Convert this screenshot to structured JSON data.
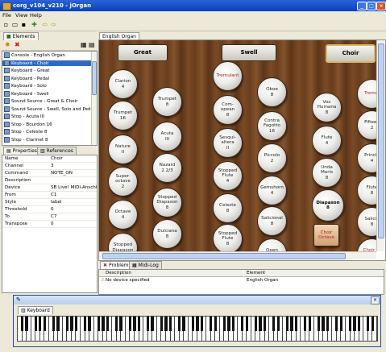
{
  "window": {
    "title": "corg_v104_v210 - jOrgan"
  },
  "menu": [
    "File",
    "View",
    "Help"
  ],
  "elements_tab": "Elements",
  "elements": [
    {
      "label": "Console - English Organ",
      "selected": false
    },
    {
      "label": "Keyboard - Choir",
      "selected": true
    },
    {
      "label": "Keyboard - Great",
      "selected": false
    },
    {
      "label": "Keyboard - Pedal",
      "selected": false
    },
    {
      "label": "Keyboard - Solo",
      "selected": false
    },
    {
      "label": "Keyboard - Swell",
      "selected": false
    },
    {
      "label": "Sound Source - Great & Choir",
      "selected": false
    },
    {
      "label": "Sound Source - Swell, Solo and Pedal",
      "selected": false
    },
    {
      "label": "Stop - Acuta  III",
      "selected": false
    },
    {
      "label": "Stop - Bourdon  16",
      "selected": false
    },
    {
      "label": "Stop - Celeste  8",
      "selected": false
    },
    {
      "label": "Stop - Clarinet  8",
      "selected": false
    }
  ],
  "props_tabs": [
    "Properties",
    "References"
  ],
  "properties": [
    {
      "key": "Name",
      "value": "Choir"
    },
    {
      "key": "Channel",
      "value": "3"
    },
    {
      "key": "Command",
      "value": "NOTE_ON"
    },
    {
      "key": "Description",
      "value": ""
    },
    {
      "key": "Device",
      "value": "SB Live! MIDI-Anschlus..."
    },
    {
      "key": "From",
      "value": "C1"
    },
    {
      "key": "Style",
      "value": "label"
    },
    {
      "key": "Threshold",
      "value": "0"
    },
    {
      "key": "To",
      "value": "C7"
    },
    {
      "key": "Transpose",
      "value": "0"
    }
  ],
  "console_tab": "English Organ",
  "manuals": {
    "great": "Great",
    "swell": "Swell",
    "choir": "Choir"
  },
  "stops": [
    {
      "label": "Clarion\n4",
      "red": false,
      "on": false
    },
    {
      "label": "Trumpet\n16",
      "red": false,
      "on": false
    },
    {
      "label": "Nature\nII",
      "red": false,
      "on": false
    },
    {
      "label": "Super-\noctave\n2",
      "red": false,
      "on": false
    },
    {
      "label": "Octave\n4",
      "red": false,
      "on": false
    },
    {
      "label": "Stopped\nDiapason",
      "red": false,
      "on": false
    },
    {
      "label": "Trumpet\n8",
      "red": false,
      "on": false
    },
    {
      "label": "Acuta\nIII",
      "red": false,
      "on": false
    },
    {
      "label": "Nazard\n2 2/3",
      "red": false,
      "on": false
    },
    {
      "label": "Stopped\nDiapason\n8",
      "red": false,
      "on": false
    },
    {
      "label": "Dulciana\n8",
      "red": false,
      "on": false
    },
    {
      "label": "Tremulant",
      "red": true,
      "on": false
    },
    {
      "label": "Com-\nopean\n8",
      "red": false,
      "on": false
    },
    {
      "label": "Sesqui-\naltera\nII",
      "red": false,
      "on": false
    },
    {
      "label": "Stopped\nFlute\n4",
      "red": false,
      "on": false
    },
    {
      "label": "Celeste\n8",
      "red": false,
      "on": false
    },
    {
      "label": "Stopped\nFlute\n8",
      "red": false,
      "on": false
    },
    {
      "label": "Oboe\n8",
      "red": false,
      "on": false
    },
    {
      "label": "Contra\nFagotto\n16",
      "red": false,
      "on": false
    },
    {
      "label": "Piccolo\n2",
      "red": false,
      "on": false
    },
    {
      "label": "Gemshorn\n4",
      "red": false,
      "on": false
    },
    {
      "label": "Salicional\n8",
      "red": false,
      "on": false
    },
    {
      "label": "Open\nDiapason",
      "red": false,
      "on": false
    },
    {
      "label": "Vox\nHumana\n8",
      "red": false,
      "on": false
    },
    {
      "label": "Flute\n4",
      "red": false,
      "on": false
    },
    {
      "label": "Unda\nMaris\n8",
      "red": false,
      "on": false
    },
    {
      "label": "Diapason\n8",
      "red": false,
      "on": true
    },
    {
      "label": "Choir\nOctave",
      "red": true,
      "on": false
    },
    {
      "label": "Tremul",
      "red": true,
      "on": false
    },
    {
      "label": "Fifteen\n2",
      "red": false,
      "on": false
    },
    {
      "label": "Princip\n4",
      "red": false,
      "on": false
    },
    {
      "label": "Flute\n8",
      "red": false,
      "on": false
    },
    {
      "label": "Salicio\n8",
      "red": false,
      "on": false
    },
    {
      "label": "Choir to\nSwell",
      "red": true,
      "on": false
    }
  ],
  "problems": {
    "tabs": [
      "Problems",
      "Midi-Log"
    ],
    "columns": [
      "Description",
      "Element"
    ],
    "rows": [
      {
        "description": "No device specified",
        "element": "English Organ"
      }
    ]
  },
  "keyboard_tab": "Keyboard",
  "colors": {
    "titlebar": "#0a3fb8",
    "selection": "#316ac5",
    "wood": "#6a3d1d",
    "red_label": "#b21c1c"
  }
}
